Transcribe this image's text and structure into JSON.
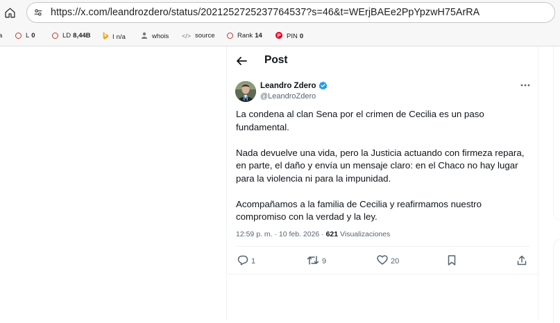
{
  "browser": {
    "url": "https://x.com/leandrozdero/status/2021252725237764537?s=46&t=WErjBAEe2PpYpzwH75ArRA",
    "extensions": [
      {
        "id": "a",
        "label": "a",
        "value": ""
      },
      {
        "id": "l",
        "label": "L",
        "value": "0"
      },
      {
        "id": "ld",
        "label": "LD",
        "value": "8,44B"
      },
      {
        "id": "i",
        "label": "I",
        "value": "n/a"
      },
      {
        "id": "whois",
        "label": "whois",
        "value": ""
      },
      {
        "id": "source",
        "label": "source",
        "value": ""
      },
      {
        "id": "rank",
        "label": "Rank",
        "value": "14"
      },
      {
        "id": "pin",
        "label": "PIN",
        "value": "0"
      }
    ]
  },
  "header": {
    "title": "Post"
  },
  "author": {
    "name": "Leandro Zdero",
    "handle": "@LeandroZdero"
  },
  "tweet": {
    "paragraphs": [
      "La condena al clan Sena por el crimen de Cecilia es un paso fundamental.",
      "Nada devuelve una vida, pero la Justicia actuando con firmeza repara, en parte, el daño y envía un mensaje claro: en el Chaco no hay lugar para la violencia ni para la impunidad.",
      "Acompañamos a la familia de Cecilia y reafirmamos nuestro compromiso con la verdad y la ley."
    ],
    "time": "12:59 p. m. · 10 feb. 2026 · ",
    "views_count": "621",
    "views_label": " Visualizaciones"
  },
  "actions": {
    "replies": "1",
    "reposts": "9",
    "likes": "20"
  },
  "colors": {
    "accent": "#1d9bf0",
    "secondary_text": "#536471",
    "extension_ring": "#c0392b"
  }
}
